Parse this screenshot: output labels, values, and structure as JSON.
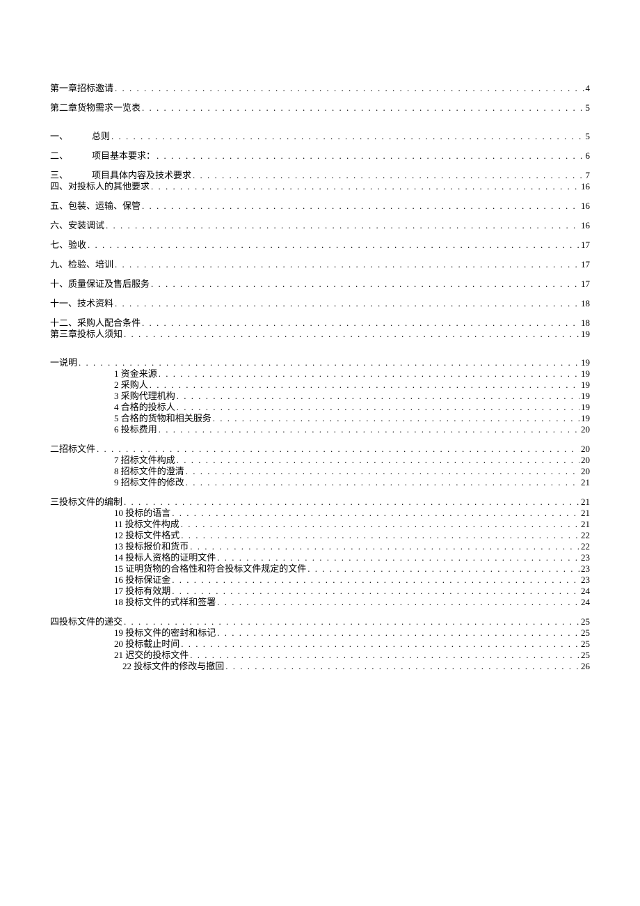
{
  "entries": [
    {
      "level": "lvl0",
      "label": "第一章招标邀请",
      "page": 4,
      "extraGapBelow": false
    },
    {
      "level": "lvl0",
      "label": "第二章货物需求一览表",
      "page": 5,
      "extraGapBelow": true
    },
    {
      "level": "lvl1",
      "num": "一、",
      "title": "总则",
      "page": 5
    },
    {
      "level": "lvl1",
      "num": "二、",
      "title": "项目基本要求：",
      "page": 6
    },
    {
      "level": "lvl1",
      "num": "三、",
      "title": "项目具体内容及技术要求",
      "page": 7
    },
    {
      "level": "lvl0",
      "label": "四、对投标人的其他要求",
      "page": 16,
      "tightAbove": true
    },
    {
      "level": "lvl0",
      "label": "五、包装、运输、保管",
      "page": 16
    },
    {
      "level": "lvl0",
      "label": "六、安装调试",
      "page": 16
    },
    {
      "level": "lvl0",
      "label": "七、验收",
      "page": 17
    },
    {
      "level": "lvl0",
      "label": "九、检验、培训",
      "page": 17
    },
    {
      "level": "lvl0",
      "label": "十、质量保证及售后服务",
      "page": 17
    },
    {
      "level": "lvl0",
      "label": "十一、技术资料",
      "page": 18
    },
    {
      "level": "lvl0",
      "label": "十二、采购人配合条件",
      "page": 18
    },
    {
      "level": "lvl0",
      "label": "第三章投标人须知",
      "page": 19,
      "tightAbove": true,
      "extraGapBelow": true
    },
    {
      "level": "lvl0",
      "label": "一说明",
      "page": 19
    },
    {
      "level": "lvl2",
      "label": "1 资金来源",
      "page": 19,
      "tightAbove": true
    },
    {
      "level": "lvl2",
      "label": "2 采购人",
      "page": 19,
      "tightAbove": true
    },
    {
      "level": "lvl2",
      "label": "3 采购代理机构",
      "page": 19,
      "tightAbove": true
    },
    {
      "level": "lvl2",
      "label": "4 合格的投标人",
      "page": 19,
      "tightAbove": true
    },
    {
      "level": "lvl2",
      "label": "5 合格的货物和相关服务",
      "page": 19,
      "tightAbove": true
    },
    {
      "level": "lvl2",
      "label": "6 投标费用",
      "page": 20,
      "tightAbove": true
    },
    {
      "level": "lvl0",
      "label": "二招标文件",
      "page": 20
    },
    {
      "level": "lvl2",
      "label": "7 招标文件构成",
      "page": 20,
      "tightAbove": true
    },
    {
      "level": "lvl2",
      "label": "8 招标文件的澄清",
      "page": 20,
      "tightAbove": true
    },
    {
      "level": "lvl2",
      "label": "9 招标文件的修改",
      "page": 21,
      "tightAbove": true
    },
    {
      "level": "lvl0",
      "label": "三投标文件的编制",
      "page": 21
    },
    {
      "level": "lvl2",
      "label": "10 投标的语言",
      "page": 21,
      "tightAbove": true
    },
    {
      "level": "lvl2",
      "label": "11 投标文件构成",
      "page": 21,
      "tightAbove": true
    },
    {
      "level": "lvl2",
      "label": "12 投标文件格式",
      "page": 22,
      "tightAbove": true
    },
    {
      "level": "lvl2",
      "label": "13 投标报价和货币",
      "page": 22,
      "tightAbove": true
    },
    {
      "level": "lvl2",
      "label": "14 投标人资格的证明文件",
      "page": 23,
      "tightAbove": true
    },
    {
      "level": "lvl2",
      "label": "15 证明货物的合格性和符合投标文件规定的文件",
      "page": 23,
      "tightAbove": true
    },
    {
      "level": "lvl2",
      "label": "16 投标保证金",
      "page": 23,
      "tightAbove": true
    },
    {
      "level": "lvl2",
      "label": "17 投标有效期",
      "page": 24,
      "tightAbove": true
    },
    {
      "level": "lvl2",
      "label": "18 投标文件的式样和签署",
      "page": 24,
      "tightAbove": true
    },
    {
      "level": "lvl0",
      "label": "四投标文件的递交",
      "page": 25
    },
    {
      "level": "lvl2",
      "label": "19 投标文件的密封和标记",
      "page": 25,
      "tightAbove": true
    },
    {
      "level": "lvl2",
      "label": "20 投标截止时间",
      "page": 25,
      "tightAbove": true
    },
    {
      "level": "lvl2",
      "label": "21 迟交的投标文件",
      "page": 25,
      "tightAbove": true
    },
    {
      "level": "lvl2b",
      "label": "22 投标文件的修改与撤回",
      "page": 26,
      "tightAbove": true
    }
  ]
}
